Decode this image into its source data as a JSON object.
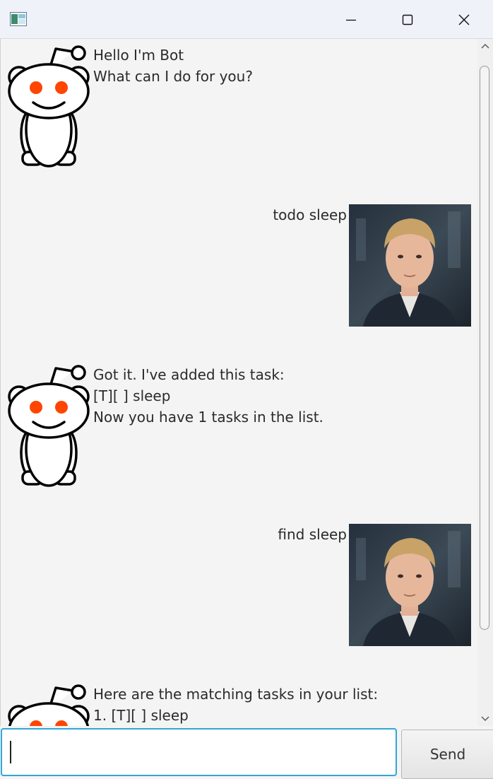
{
  "window": {
    "icon": "app-icon",
    "controls": [
      "minimize-icon",
      "maximize-icon",
      "close-icon"
    ]
  },
  "messages": [
    {
      "sender": "bot",
      "lines": [
        "Hello I'm Bot",
        "What can I do for you?"
      ]
    },
    {
      "sender": "user",
      "text": "todo sleep"
    },
    {
      "sender": "bot",
      "lines": [
        "Got it. I've added this task:",
        "[T][ ] sleep",
        "Now you have 1 tasks in the list."
      ]
    },
    {
      "sender": "user",
      "text": "find sleep"
    },
    {
      "sender": "bot",
      "lines": [
        "Here are the matching tasks in your list:",
        "1. [T][ ] sleep"
      ]
    }
  ],
  "input": {
    "value": "",
    "placeholder": ""
  },
  "send_button": {
    "label": "Send"
  },
  "colors": {
    "accent": "#33a6d6",
    "bot_eye": "#ff4500"
  }
}
